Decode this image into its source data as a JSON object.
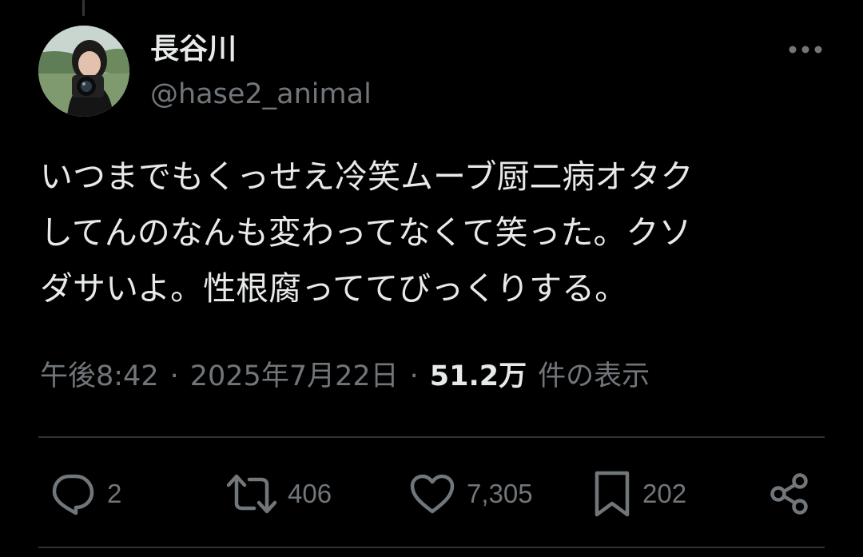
{
  "author": {
    "display_name": "長谷川",
    "handle": "@hase2_animal",
    "avatar_icon": "avatar-photo-camera"
  },
  "header": {
    "more_icon": "more-dots-icon"
  },
  "tweet": {
    "text": "いつまでもくっせえ冷笑ムーブ厨二病オタク\nしてんのなんも変わってなくて笑った。クソ\nダサいよ。性根腐っててびっくりする。"
  },
  "meta": {
    "time": "午後8:42",
    "separator": "·",
    "date": "2025年7月22日",
    "views_count": "51.2万",
    "views_label": "件の表示"
  },
  "actions": {
    "reply": {
      "icon": "reply-icon",
      "count": "2"
    },
    "retweet": {
      "icon": "retweet-icon",
      "count": "406"
    },
    "like": {
      "icon": "heart-icon",
      "count": "7,305"
    },
    "bookmark": {
      "icon": "bookmark-icon",
      "count": "202"
    },
    "share": {
      "icon": "share-icon"
    }
  },
  "colors": {
    "background": "#000000",
    "primary_text": "#e7e9ea",
    "secondary_text": "#71767b",
    "divider": "#2f3336"
  }
}
